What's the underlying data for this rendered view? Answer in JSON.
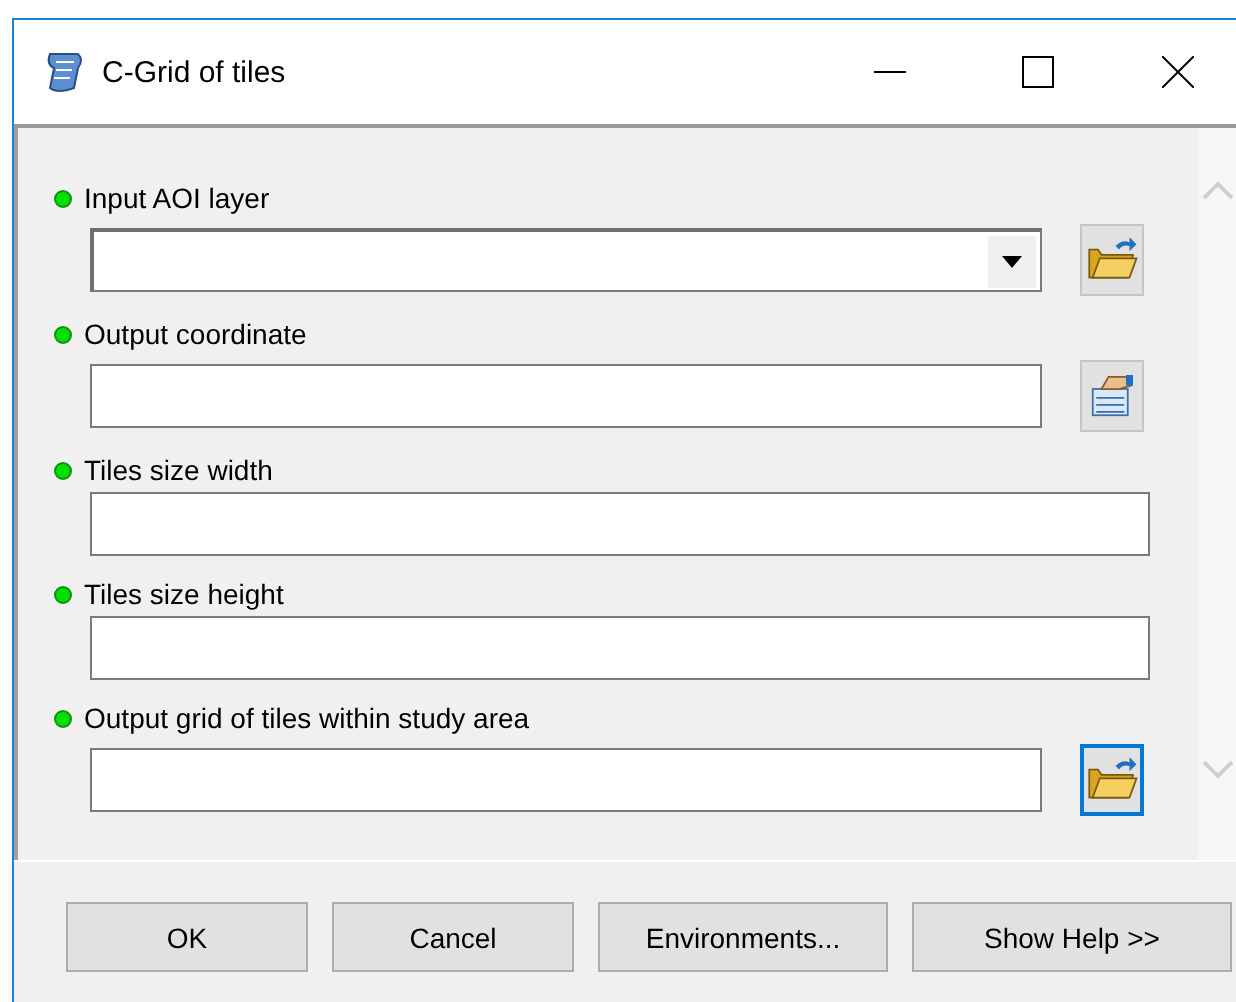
{
  "window": {
    "title": "C-Grid of tiles"
  },
  "parameters": [
    {
      "label": "Input AOI layer",
      "kind": "dropdown",
      "button": {
        "kind": "folder",
        "focused": false
      }
    },
    {
      "label": "Output coordinate",
      "kind": "text",
      "button": {
        "kind": "properties",
        "focused": false
      }
    },
    {
      "label": "Tiles size width",
      "kind": "text"
    },
    {
      "label": "Tiles size height",
      "kind": "text"
    },
    {
      "label": "Output grid of tiles within study area",
      "kind": "text",
      "button": {
        "kind": "folder",
        "focused": true
      }
    }
  ],
  "buttons": [
    "OK",
    "Cancel",
    "Environments...",
    "Show Help >>"
  ]
}
